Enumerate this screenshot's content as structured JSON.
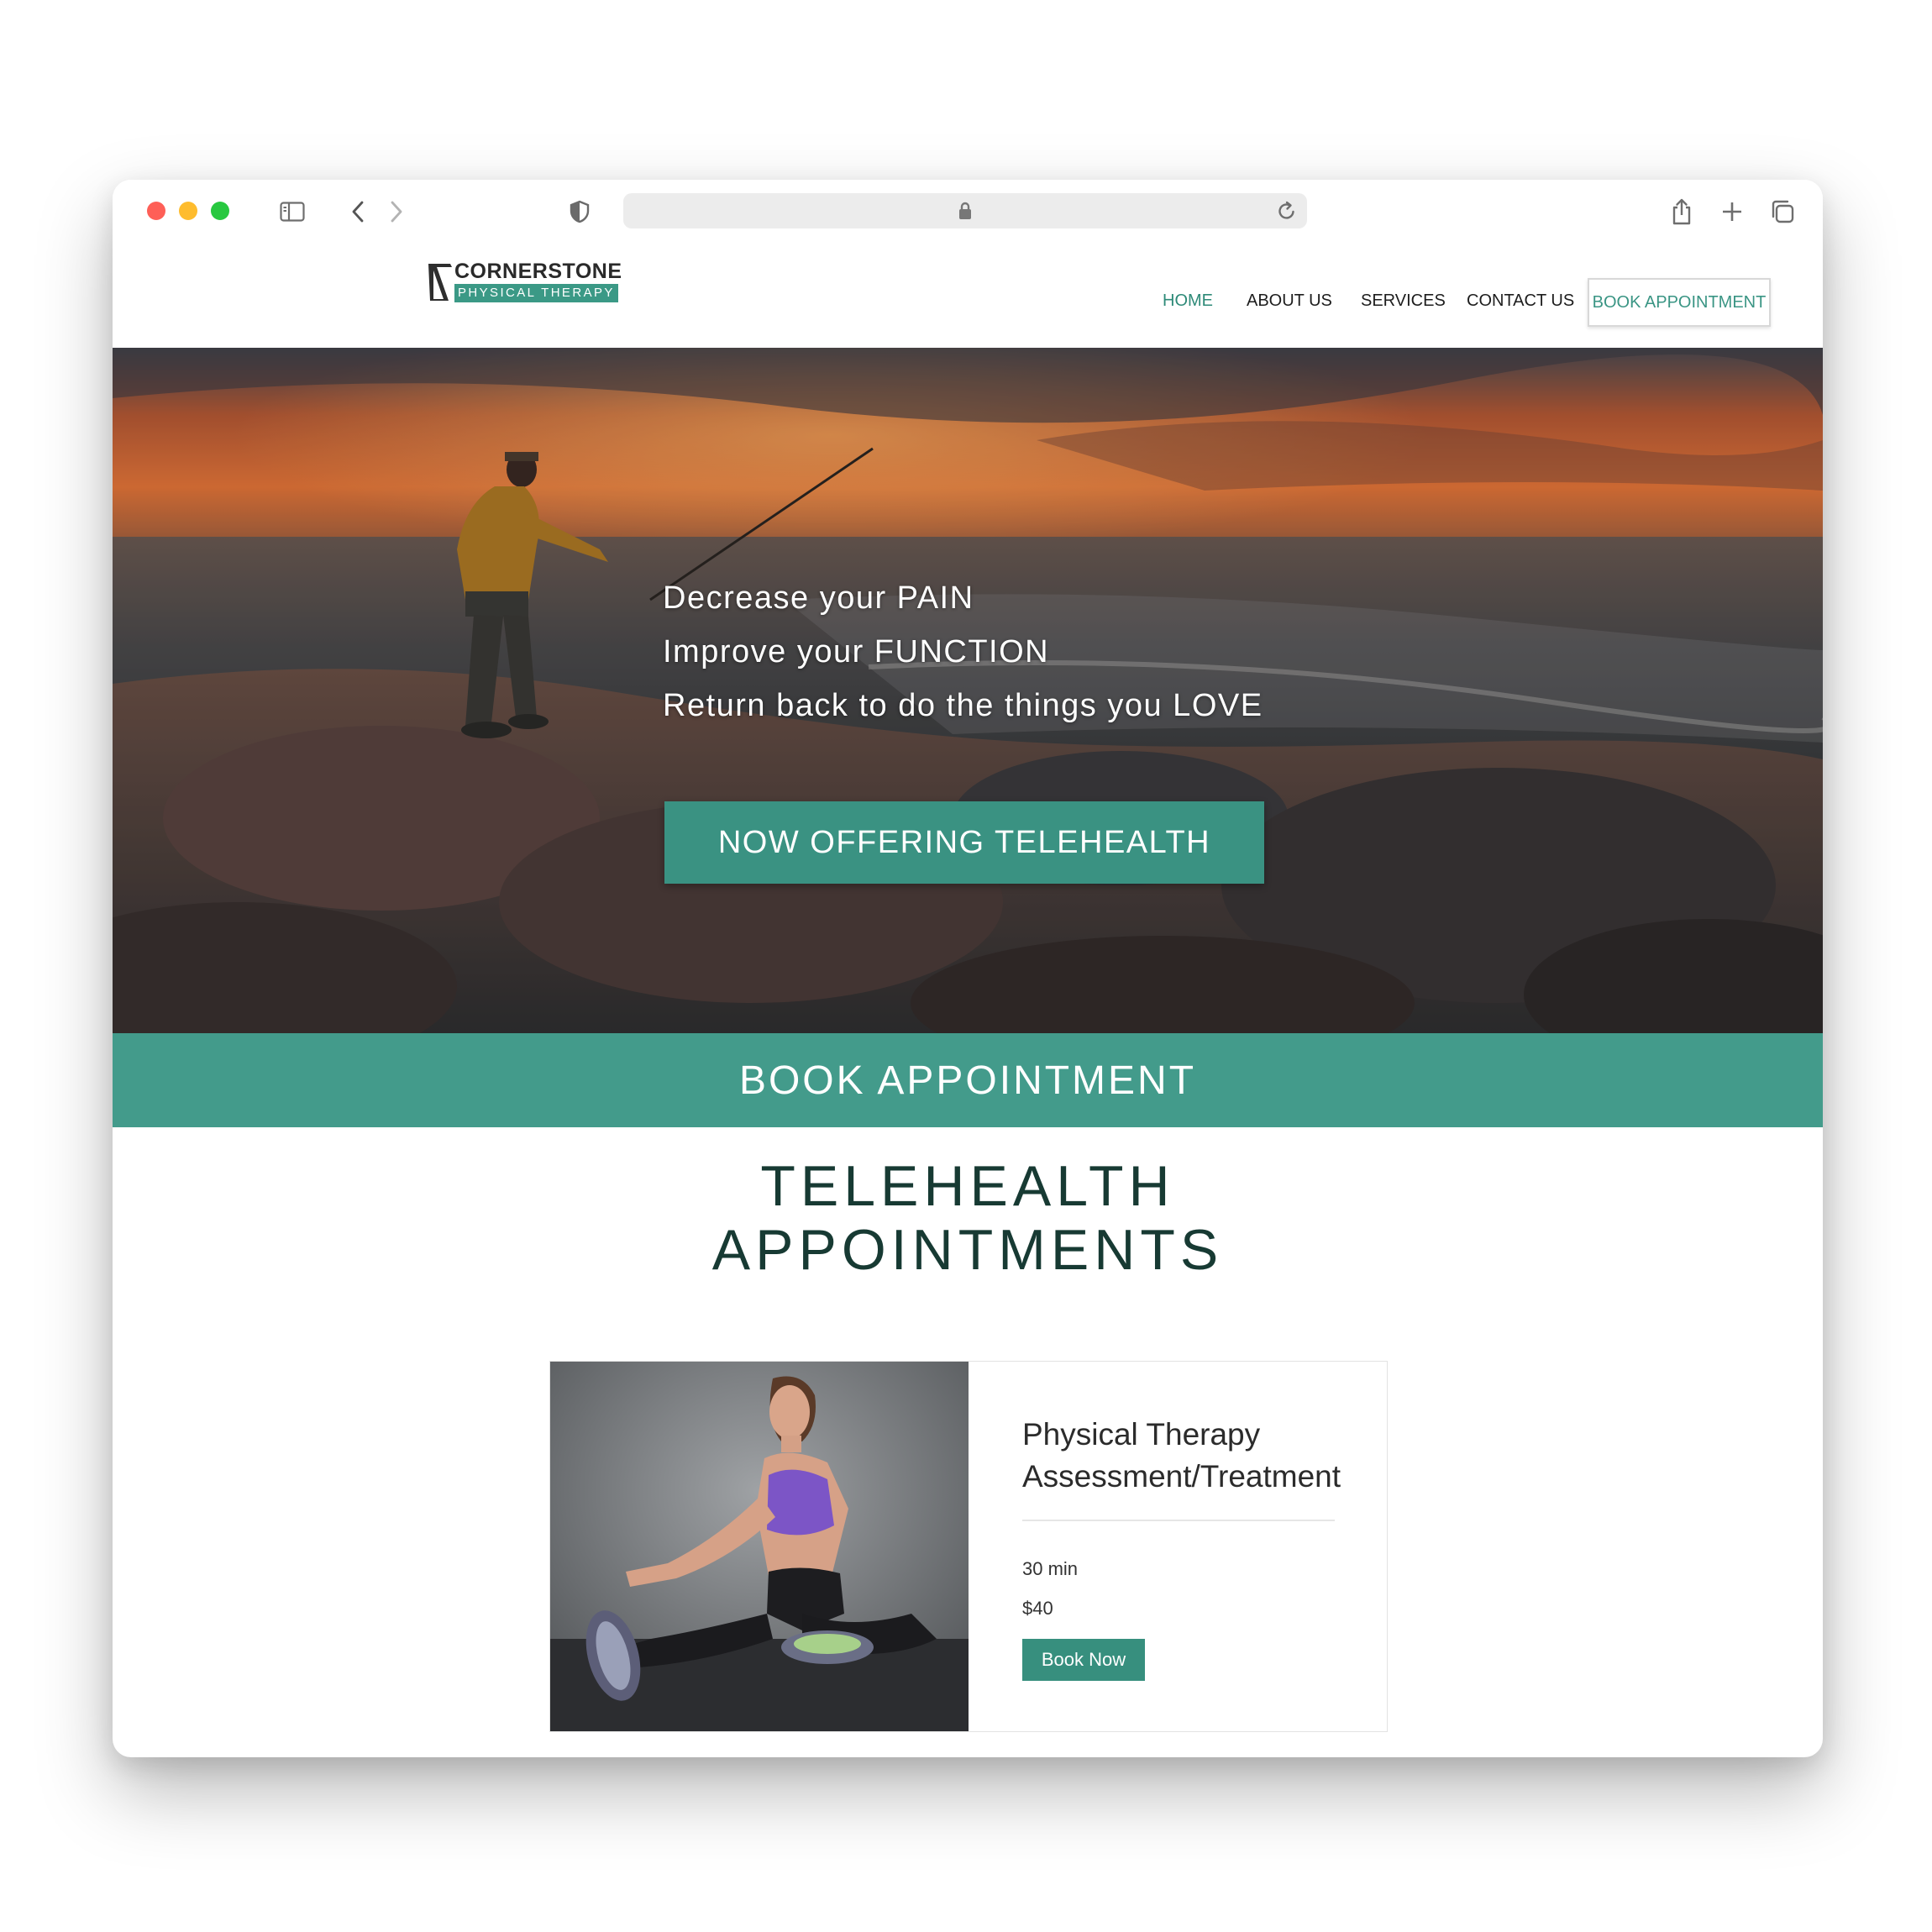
{
  "browser": {
    "icons": [
      "sidebar-icon",
      "back-icon",
      "forward-icon",
      "shield-icon",
      "lock-icon",
      "reload-icon",
      "share-icon",
      "new-tab-icon",
      "tabs-overview-icon"
    ]
  },
  "site": {
    "logo": {
      "top": "CORNERSTONE",
      "bottom": "PHYSICAL THERAPY"
    },
    "nav": {
      "home": "HOME",
      "about": "ABOUT US",
      "services": "SERVICES",
      "contact": "CONTACT US",
      "book": "BOOK APPOINTMENT"
    },
    "accent_color": "#3b9986"
  },
  "hero": {
    "line1": "Decrease your PAIN",
    "line2": "Improve your FUNCTION",
    "line3": "Return back to do the things you LOVE",
    "cta": "NOW OFFERING TELEHEALTH"
  },
  "banner": {
    "label": "BOOK APPOINTMENT",
    "color": "#439b8b"
  },
  "telehealth": {
    "title_line1": "TELEHEALTH",
    "title_line2": "APPOINTMENTS",
    "card": {
      "title": "Physical Therapy Assessment/Treatment",
      "duration": "30 min",
      "price": "$40",
      "button": "Book Now"
    }
  }
}
